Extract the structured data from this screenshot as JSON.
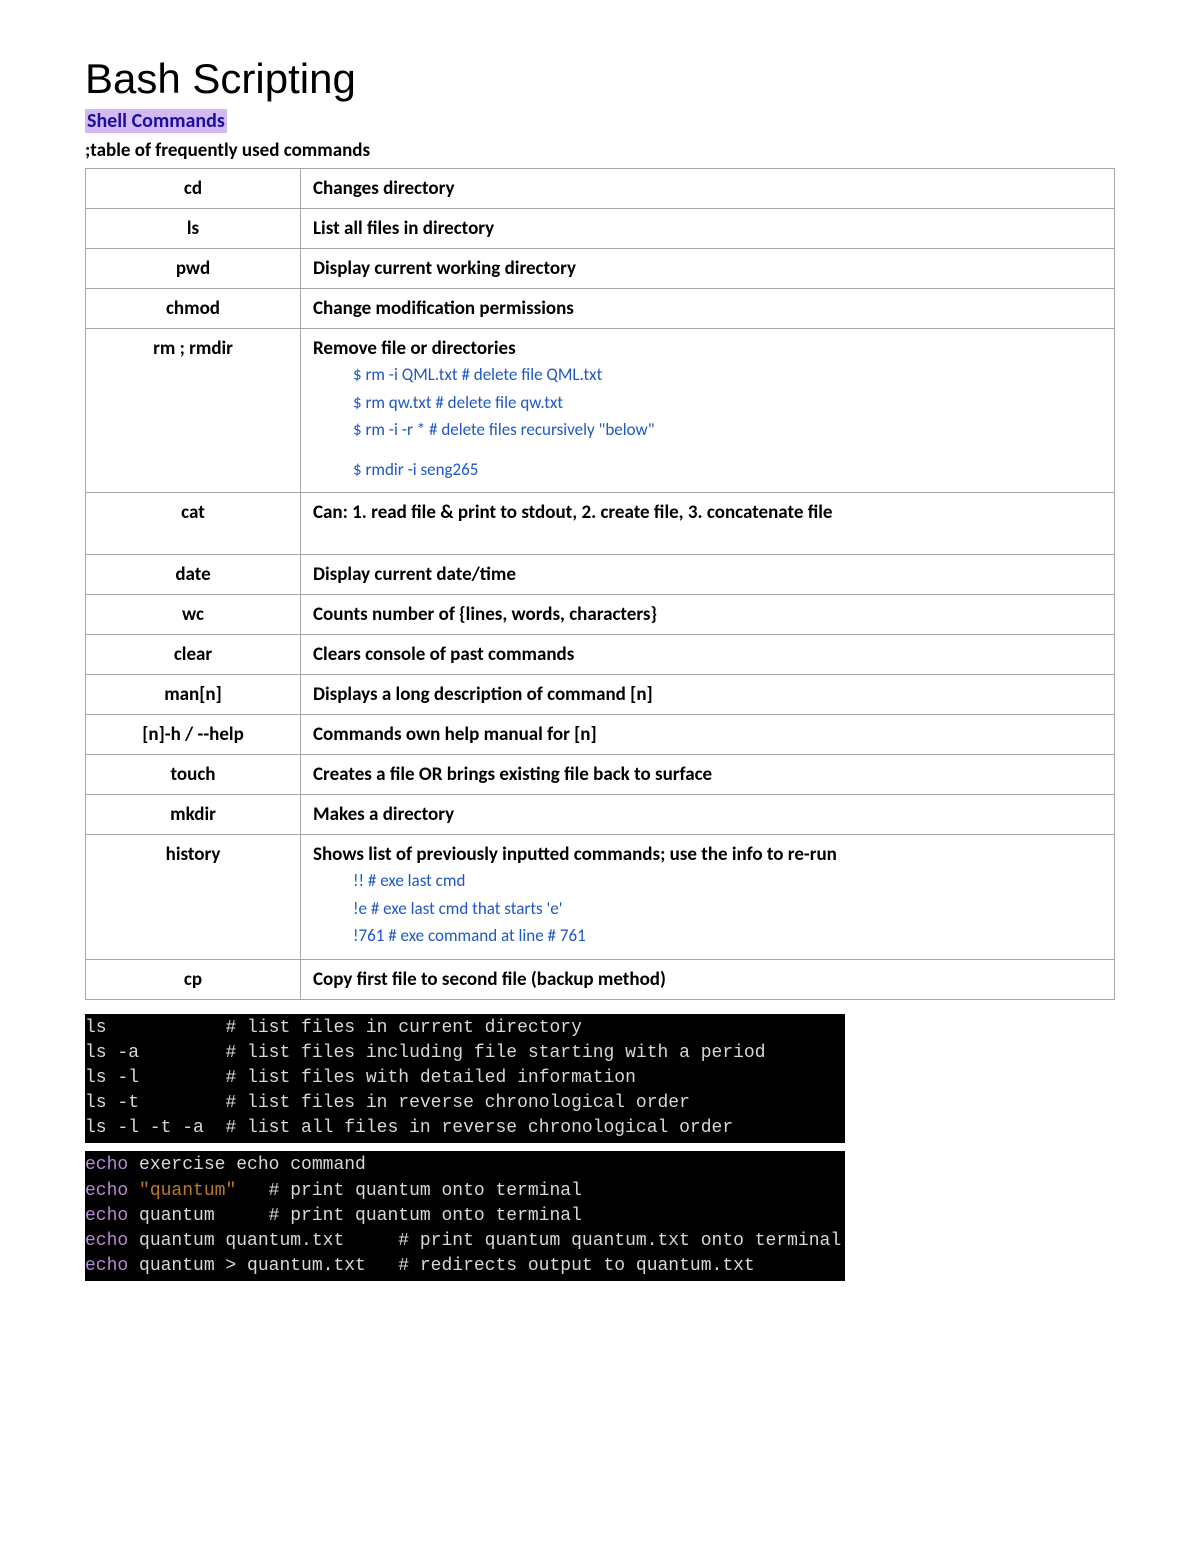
{
  "title": "Bash Scripting",
  "section_heading": "Shell Commands",
  "subtitle": ";table of frequently used commands",
  "commands": [
    {
      "cmd": "cd",
      "desc": "Changes directory"
    },
    {
      "cmd": "ls",
      "desc": "List all files in directory"
    },
    {
      "cmd": "pwd",
      "desc": "Display current working directory"
    },
    {
      "cmd": "chmod",
      "desc": "Change modification permissions"
    },
    {
      "cmd": "rm ; rmdir",
      "desc": "Remove file or directories",
      "code": [
        "$ rm -i QML.txt   # delete file QML.txt",
        "$ rm qw.txt           # delete file qw.txt",
        "$ rm -i -r *   # delete files recursively \"below\"",
        "",
        "$ rmdir -i seng265"
      ]
    },
    {
      "cmd": "cat",
      "desc": "Can: 1. read file & print to stdout, 2. create file, 3. concatenate file",
      "tall": true
    },
    {
      "cmd": "date",
      "desc": "Display current date/time"
    },
    {
      "cmd": "wc",
      "desc": "Counts number of {lines, words, characters}"
    },
    {
      "cmd": "clear",
      "desc": "Clears console of past commands"
    },
    {
      "cmd": "man[n]",
      "desc": "Displays a long description of command [n]"
    },
    {
      "cmd": "[n]-h / --help",
      "desc": "Commands own help manual for [n]"
    },
    {
      "cmd": "touch",
      "desc": "Creates a file OR brings existing file back to surface"
    },
    {
      "cmd": "mkdir",
      "desc": "Makes a directory"
    },
    {
      "cmd": "history",
      "desc": "Shows list of previously inputted commands; use the info to re-run",
      "code": [
        "!!        # exe last cmd",
        "!e        # exe last cmd that starts 'e'",
        "!761    # exe command at line # 761"
      ]
    },
    {
      "cmd": "cp",
      "desc": "Copy first file to second file (backup method)"
    }
  ],
  "terminal1": [
    [
      "ls           ",
      "# list files in current directory"
    ],
    [
      "ls -a        ",
      "# list files including file starting with a period"
    ],
    [
      "ls -l        ",
      "# list files with detailed information"
    ],
    [
      "ls -t        ",
      "# list files in reverse chronological order"
    ],
    [
      "ls -l -t -a  ",
      "# list all files in reverse chronological order"
    ]
  ],
  "terminal2": [
    {
      "parts": [
        {
          "t": "echo",
          "c": "echo"
        },
        {
          "t": " exercise echo command",
          "c": "cmd"
        }
      ]
    },
    {
      "parts": [
        {
          "t": "echo",
          "c": "echo"
        },
        {
          "t": " ",
          "c": "cmd"
        },
        {
          "t": "\"quantum\"",
          "c": "str"
        },
        {
          "t": "   # print quantum onto terminal",
          "c": "comment"
        }
      ]
    },
    {
      "parts": [
        {
          "t": "echo",
          "c": "echo"
        },
        {
          "t": " quantum     # print quantum onto terminal",
          "c": "cmd"
        }
      ]
    },
    {
      "parts": [
        {
          "t": "echo",
          "c": "echo"
        },
        {
          "t": " quantum quantum.txt     # print quantum quantum.txt onto terminal",
          "c": "cmd"
        }
      ]
    },
    {
      "parts": [
        {
          "t": "echo",
          "c": "echo"
        },
        {
          "t": " quantum > quantum.txt   # redirects output to quantum.txt",
          "c": "cmd"
        }
      ]
    }
  ]
}
